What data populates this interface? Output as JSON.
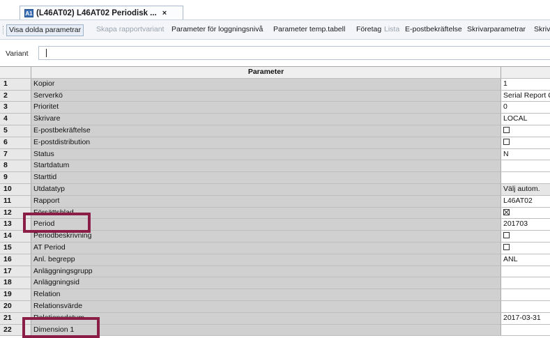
{
  "tab": {
    "icon_text": "A1",
    "title": "(L46AT02) L46AT02 Periodisk ...",
    "close_glyph": "×"
  },
  "toolbar": {
    "buttons": [
      {
        "label": "Visa dolda parametrar",
        "state": "pressed"
      },
      {
        "label": "Skapa rapportvariant",
        "state": "disabled"
      },
      {
        "label": "Parameter för loggningsnivå",
        "state": "normal"
      },
      {
        "label": "Parameter temp.tabell",
        "state": "normal"
      },
      {
        "label": "Företag",
        "state": "normal"
      },
      {
        "label": "Lista",
        "state": "disabled"
      },
      {
        "label": "E-postbekräftelse",
        "state": "normal"
      },
      {
        "label": "Skrivarparametrar",
        "state": "normal"
      },
      {
        "label": "Skriv",
        "state": "normal"
      }
    ]
  },
  "variant": {
    "label": "Variant",
    "value": ""
  },
  "grid": {
    "header": "Parameter",
    "rows": [
      {
        "num": "1",
        "param": "Kopior",
        "value": "1"
      },
      {
        "num": "2",
        "param": "Serverkö",
        "value": "Serial Report Q"
      },
      {
        "num": "3",
        "param": "Prioritet",
        "value": "0"
      },
      {
        "num": "4",
        "param": "Skrivare",
        "value": "LOCAL"
      },
      {
        "num": "5",
        "param": "E-postbekräftelse",
        "checkbox": "unchecked"
      },
      {
        "num": "6",
        "param": "E-postdistribution",
        "checkbox": "unchecked"
      },
      {
        "num": "7",
        "param": "Status",
        "value": "N"
      },
      {
        "num": "8",
        "param": "Startdatum",
        "value": ""
      },
      {
        "num": "9",
        "param": "Starttid",
        "value": ""
      },
      {
        "num": "10",
        "param": "Utdatatyp",
        "value": "Välj autom.",
        "shaded": true
      },
      {
        "num": "11",
        "param": "Rapport",
        "value": "L46AT02"
      },
      {
        "num": "12",
        "param": "Försättsblad",
        "checkbox": "checked"
      },
      {
        "num": "13",
        "param": "Period",
        "value": "201703"
      },
      {
        "num": "14",
        "param": "Periodbeskrivning",
        "checkbox": "unchecked"
      },
      {
        "num": "15",
        "param": "AT Period",
        "checkbox": "unchecked"
      },
      {
        "num": "16",
        "param": "Anl. begrepp",
        "value": "ANL"
      },
      {
        "num": "17",
        "param": "Anläggningsgrupp",
        "value": ""
      },
      {
        "num": "18",
        "param": "Anläggningsid",
        "value": ""
      },
      {
        "num": "19",
        "param": "Relation",
        "value": ""
      },
      {
        "num": "20",
        "param": "Relationsvärde",
        "value": ""
      },
      {
        "num": "21",
        "param": "Relationsdatum",
        "value": "2017-03-31"
      },
      {
        "num": "22",
        "param": "Dimension 1",
        "value": ""
      }
    ]
  },
  "colors": {
    "highlight_box": "#8b1e47",
    "param_column": "#d0d0d0"
  }
}
